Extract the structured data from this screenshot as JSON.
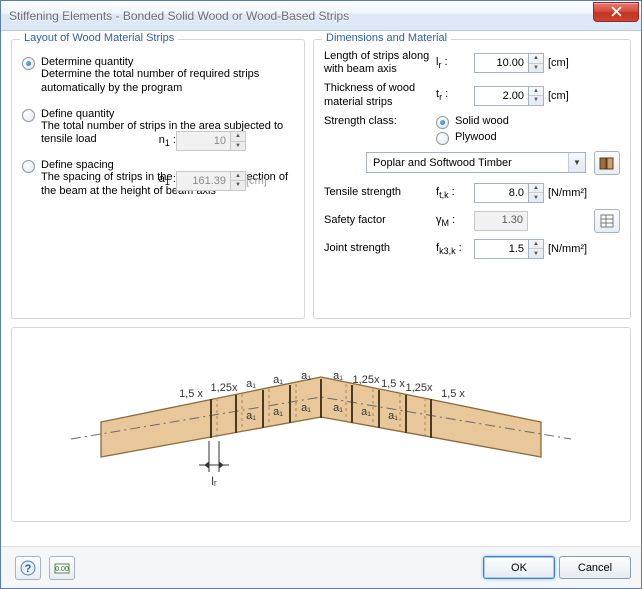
{
  "title": "Stiffening Elements - Bonded Solid Wood or Wood-Based Strips",
  "left": {
    "legend": "Layout of Wood Material Strips",
    "options": {
      "determine": {
        "label": "Determine quantity",
        "desc": "Determine the total number of required strips automatically by the program",
        "checked": true
      },
      "define_qty": {
        "label": "Define quantity",
        "desc": "The total number of strips in the area subjected to tensile load",
        "sym": "n",
        "sub": "1",
        "value": "10",
        "checked": false
      },
      "define_spacing": {
        "label": "Define spacing",
        "desc": "The spacing of strips in the longitudinal direction of the beam at the height of beam axis",
        "sym": "a",
        "sub": "1",
        "value": "161.39",
        "unit": "[cm]",
        "checked": false
      }
    }
  },
  "right": {
    "legend": "Dimensions and Material",
    "length": {
      "label": "Length of strips along with beam axis",
      "sym": "l",
      "sub": "r",
      "value": "10.00",
      "unit": "[cm]"
    },
    "thickness": {
      "label": "Thickness of wood material strips",
      "sym": "t",
      "sub": "r",
      "value": "2.00",
      "unit": "[cm]"
    },
    "strength_class": {
      "label": "Strength class:",
      "solid": "Solid wood",
      "ply": "Plywood"
    },
    "combo": "Poplar and Softwood Timber",
    "tensile": {
      "label": "Tensile strength",
      "sym": "f",
      "sub": "t,k",
      "value": "8.0",
      "unit": "[N/mm²]"
    },
    "safety": {
      "label": "Safety factor",
      "sym": "γ",
      "sub": "M",
      "value": "1.30"
    },
    "joint": {
      "label": "Joint strength",
      "sym": "f",
      "sub": "k3,k",
      "value": "1.5",
      "unit": "[N/mm²]"
    }
  },
  "diagram": {
    "labels": [
      "1,5 x",
      "1,25x",
      "a₁",
      "a₁",
      "a₁",
      "a₁",
      "1,25x",
      "1,5 x"
    ],
    "lower_labels": [
      "a₁",
      "a₁",
      "a₁",
      "a₁",
      "a₁",
      "a₁"
    ],
    "lr": "lᵣ"
  },
  "footer": {
    "ok": "OK",
    "cancel": "Cancel"
  }
}
